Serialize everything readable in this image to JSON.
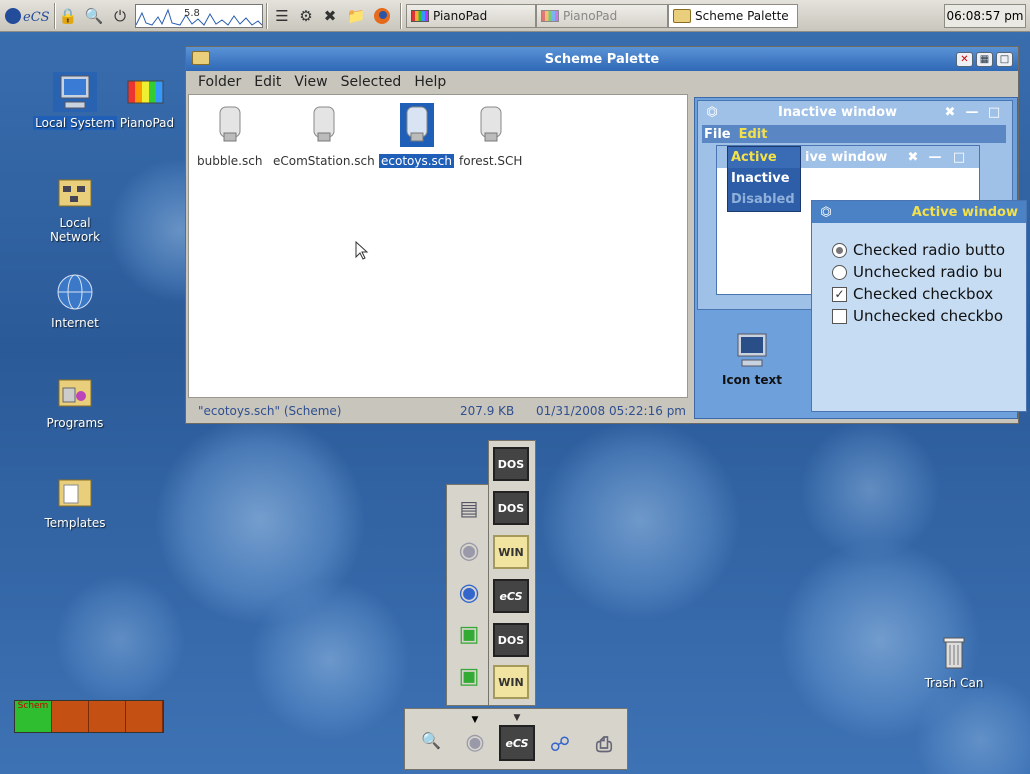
{
  "colors": {
    "accent": "#2f68b5",
    "selection": "#1f5fb8",
    "highlight_text": "#f4e14a"
  },
  "topbar": {
    "cpu_value": "5.8",
    "tasks": [
      {
        "label": "PianoPad",
        "state": "normal"
      },
      {
        "label": "PianoPad",
        "state": "dim"
      },
      {
        "label": "Scheme Palette",
        "state": "active"
      }
    ],
    "clock": "06:08:57 pm"
  },
  "desktop_icons": [
    {
      "label": "Local System",
      "icon": "computer-icon",
      "selected": true
    },
    {
      "label": "PianoPad",
      "icon": "piano-icon",
      "selected": false
    },
    {
      "label": "Local Network",
      "icon": "network-folder-icon",
      "selected": false
    },
    {
      "label": "Internet",
      "icon": "globe-icon",
      "selected": false
    },
    {
      "label": "Programs",
      "icon": "programs-folder-icon",
      "selected": false
    },
    {
      "label": "Templates",
      "icon": "templates-folder-icon",
      "selected": false
    },
    {
      "label": "Trash Can",
      "icon": "trash-icon",
      "selected": false
    }
  ],
  "window": {
    "title": "Scheme Palette",
    "menu": [
      {
        "label": "Folder"
      },
      {
        "label": "Edit"
      },
      {
        "label": "View"
      },
      {
        "label": "Selected"
      },
      {
        "label": "Help"
      }
    ],
    "files": [
      {
        "name": "bubble.sch",
        "selected": false
      },
      {
        "name": "eComStation.sch",
        "selected": false
      },
      {
        "name": "ecotoys.sch",
        "selected": true
      },
      {
        "name": "forest.SCH",
        "selected": false
      }
    ],
    "status": {
      "selection": "\"ecotoys.sch\" (Scheme)",
      "size": "207.9 KB",
      "date": "01/31/2008 05:22:16 pm"
    }
  },
  "preview": {
    "inactive_title": "Inactive window",
    "menubar": {
      "file": "File",
      "edit": "Edit"
    },
    "inner_title": "ive window",
    "popup": {
      "active": "Active",
      "inactive": "Inactive",
      "disabled": "Disabled"
    },
    "active_title": "Active window",
    "options": {
      "checked_radio": "Checked radio butto",
      "unchecked_radio": "Unchecked radio bu",
      "checked_checkbox": "Checked checkbox",
      "unchecked_checkbox": "Unchecked checkbo"
    },
    "icon_text": "Icon text"
  },
  "drawer": {
    "right_buttons": [
      "DOS",
      "DOS",
      "WIN",
      "eCS",
      "DOS",
      "WIN"
    ],
    "bottom_ecs": "eCS"
  },
  "tray": {
    "label": "Schem"
  }
}
